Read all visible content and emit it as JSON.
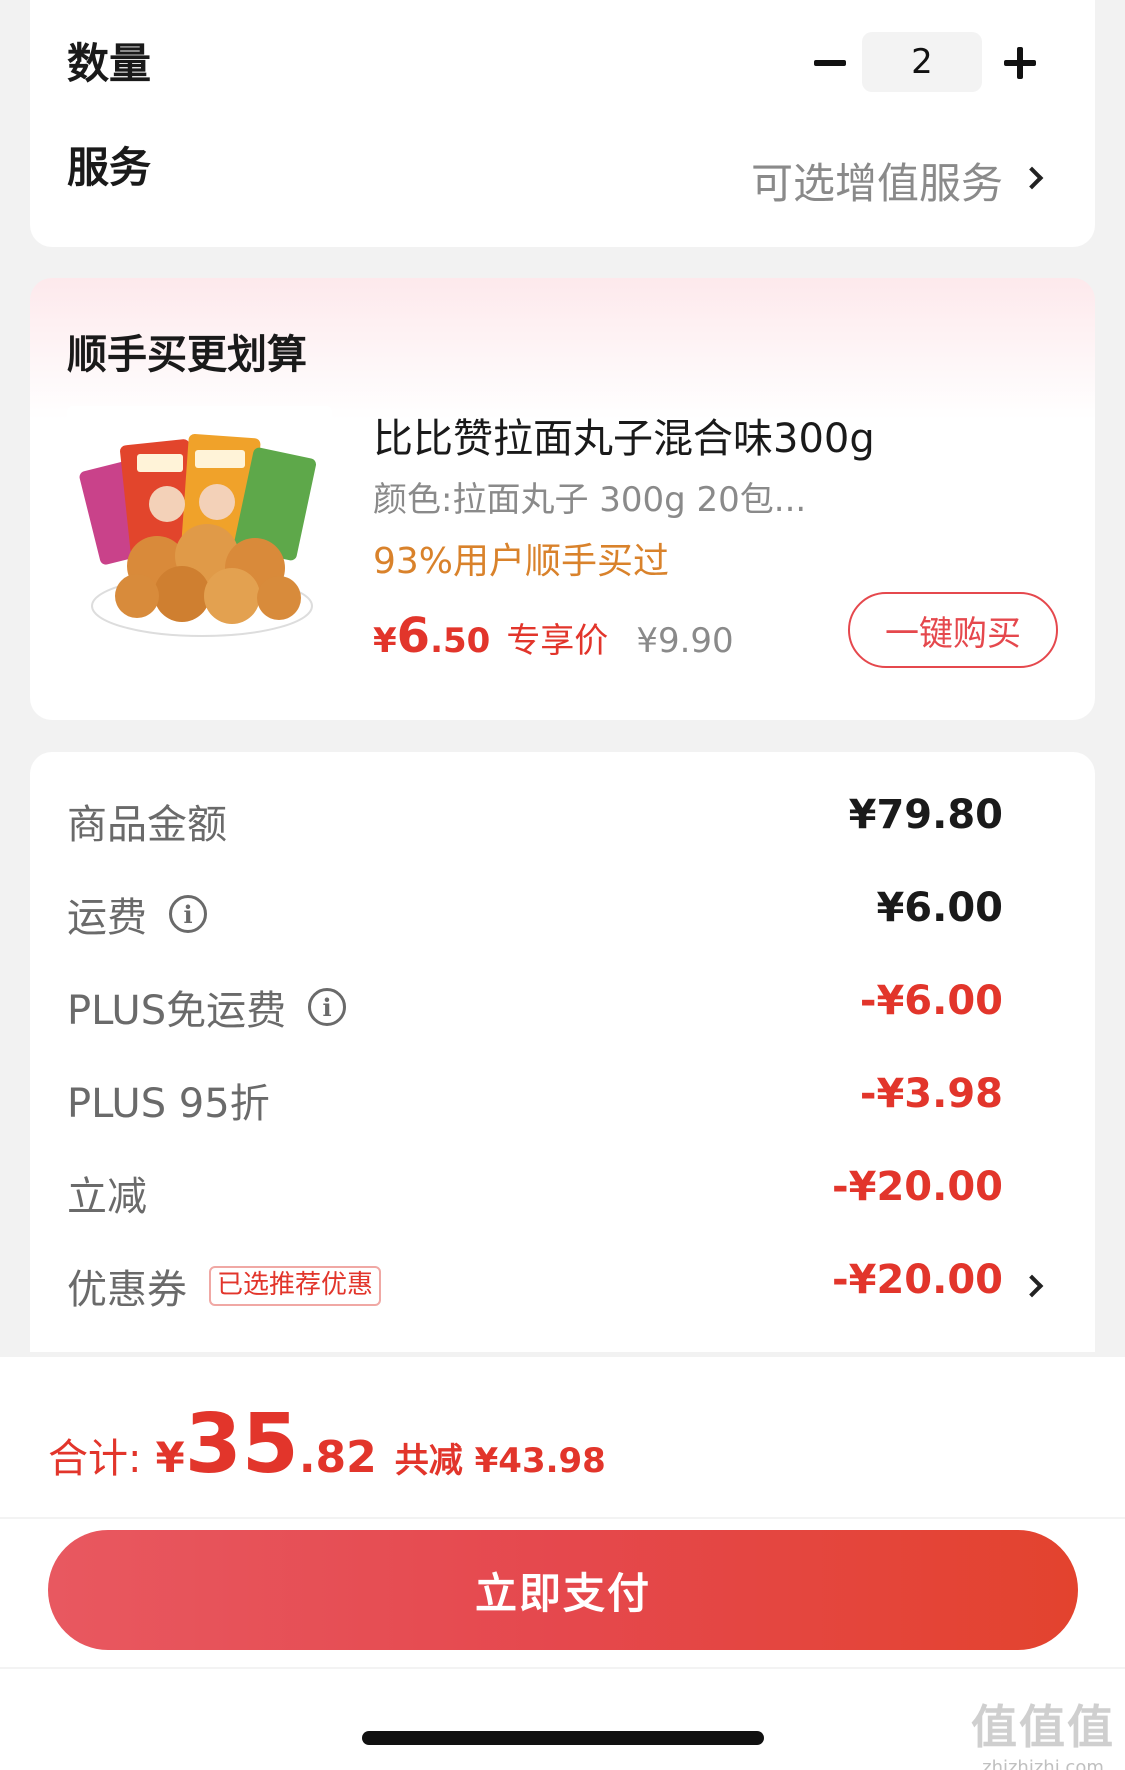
{
  "quantity": {
    "label": "数量",
    "value": "2"
  },
  "service": {
    "label": "服务",
    "value": "可选增值服务"
  },
  "upsell": {
    "title": "顺手买更划算",
    "product": {
      "name": "比比赞拉面丸子混合味300g",
      "spec": "颜色:拉面丸子 300g 20包...",
      "social_proof": "93%用户顺手买过",
      "price_symbol": "¥",
      "price_int": "6",
      "price_dec": ".50",
      "price_tag": "专享价",
      "original_price": "¥9.90",
      "image_icon": "snack-product-image"
    },
    "buy_button": "一键购买"
  },
  "summary": {
    "rows": [
      {
        "label": "商品金额",
        "value": "¥79.80",
        "info": false,
        "tone": "dark"
      },
      {
        "label": "运费",
        "value": "¥6.00",
        "info": true,
        "tone": "dark"
      },
      {
        "label": "PLUS免运费",
        "value": "-¥6.00",
        "info": true,
        "tone": "red"
      },
      {
        "label": "PLUS 95折",
        "value": "-¥3.98",
        "info": false,
        "tone": "red"
      },
      {
        "label": "立减",
        "value": "-¥20.00",
        "info": false,
        "tone": "red"
      },
      {
        "label": "优惠券",
        "badge": "已选推荐优惠",
        "value": "-¥20.00",
        "info": false,
        "tone": "red"
      }
    ],
    "info_glyph": "i"
  },
  "total": {
    "label": "合计:",
    "symbol": "¥",
    "int": "35",
    "dec": ".82",
    "saved": "共减 ¥43.98"
  },
  "pay_button": "立即支付",
  "watermark": {
    "main": "值值值",
    "sub": "zhizhizhi.com"
  },
  "colors": {
    "accent": "#e2352b",
    "upsell_orange": "#d9822b",
    "muted": "#8a8a8a"
  }
}
